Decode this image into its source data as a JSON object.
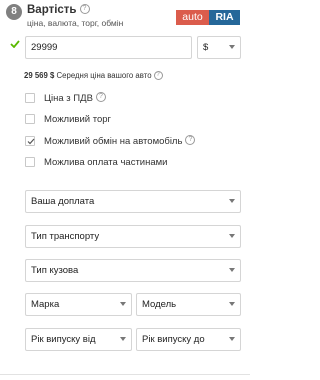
{
  "section": {
    "step_number": "8",
    "title": "Вартість",
    "subtitle": "ціна, валюта, торг, обмін"
  },
  "brand": {
    "part1": "auto",
    "part2": "RIA"
  },
  "price": {
    "value": "29999",
    "currency": "$",
    "avg_amount": "29 569 $",
    "avg_label": "Середня ціна вашого авто"
  },
  "options": [
    {
      "label": "Ціна з ПДВ",
      "checked": false,
      "help": true
    },
    {
      "label": "Можливий торг",
      "checked": false,
      "help": false
    },
    {
      "label": "Можливий обмін на автомобіль",
      "checked": true,
      "help": true
    },
    {
      "label": "Можлива оплата частинами",
      "checked": false,
      "help": false
    }
  ],
  "selects": {
    "surcharge": "Ваша доплата",
    "transport_type": "Тип транспорту",
    "body_type": "Тип кузова",
    "make": "Марка",
    "model": "Модель",
    "year_from": "Рік випуску від",
    "year_to": "Рік випуску до"
  },
  "colors": {
    "accent_green": "#5ab900",
    "brand_red": "#db5c4c",
    "brand_blue": "#256799"
  },
  "icons": {
    "help": "question-circle-icon",
    "check": "checkmark-icon",
    "chevron": "chevron-down-icon"
  }
}
